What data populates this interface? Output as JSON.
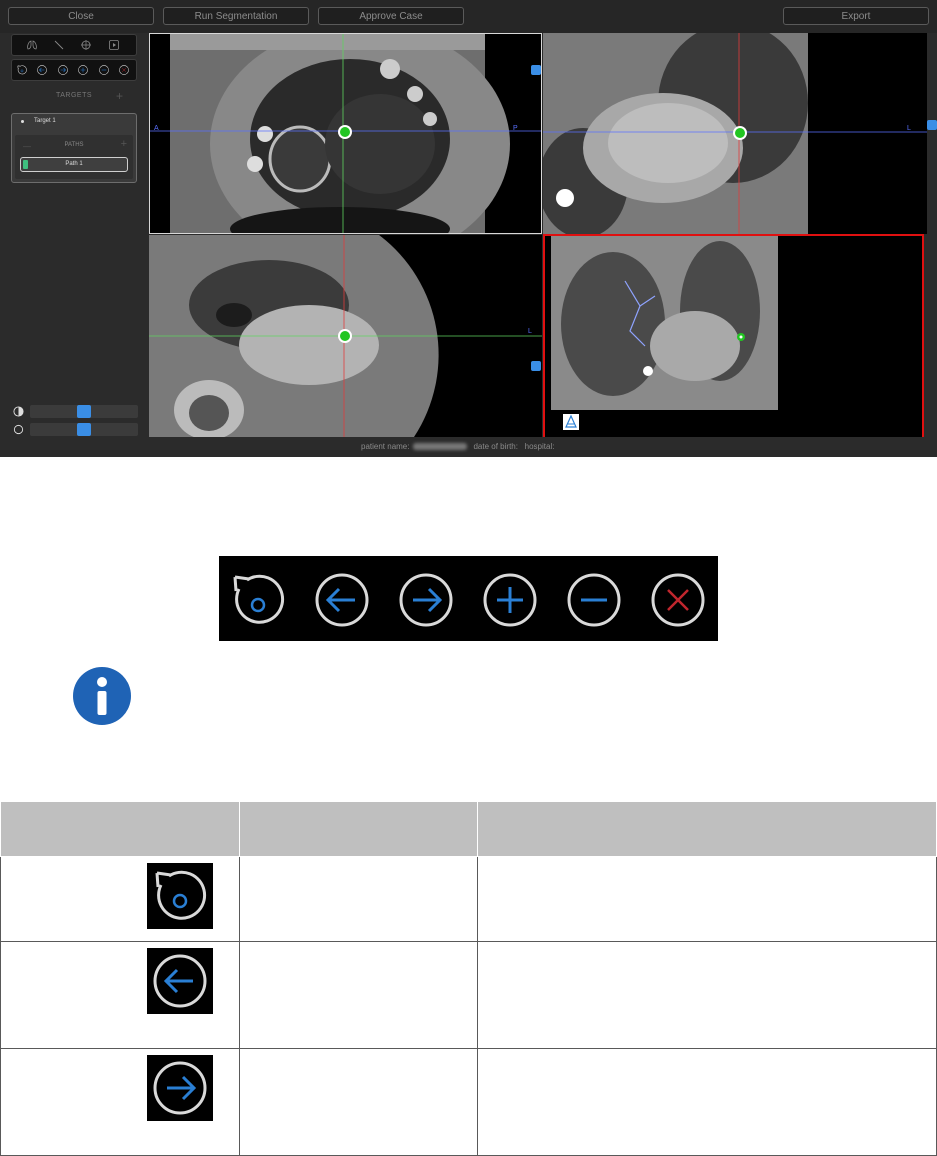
{
  "app": {
    "toolbar": {
      "close_label": "Close",
      "run_segmentation_label": "Run Segmentation",
      "approve_case_label": "Approve Case",
      "export_label": "Export"
    },
    "sidebar": {
      "targets_label": "TARGETS",
      "target_name": "Target 1",
      "paths_label": "PATHS",
      "path_name": "Path 1",
      "path_color": "#3fbf7f",
      "contrast_level": 0.5,
      "brightness_level": 0.5
    },
    "viewports": {
      "sagittal": {
        "left_label": "A",
        "right_label": "P"
      },
      "coronal": {
        "right_label": "L"
      },
      "axial": {
        "right_label": "L"
      }
    },
    "status": {
      "patient_name_label": "patient name:",
      "date_of_birth_label": "date of birth:",
      "hospital_label": "hospital:"
    },
    "colors": {
      "accent": "#3a8ee6",
      "target_marker": "#22c522",
      "highlight_border": "#e01010"
    }
  },
  "toolbar_image": {
    "icons": [
      "reset-view-icon",
      "previous-icon",
      "next-icon",
      "zoom-in-icon",
      "zoom-out-icon",
      "close-icon"
    ]
  },
  "legend_table": {
    "rows": [
      {
        "icon": "reset-view-icon"
      },
      {
        "icon": "previous-icon"
      },
      {
        "icon": "next-icon"
      }
    ]
  }
}
